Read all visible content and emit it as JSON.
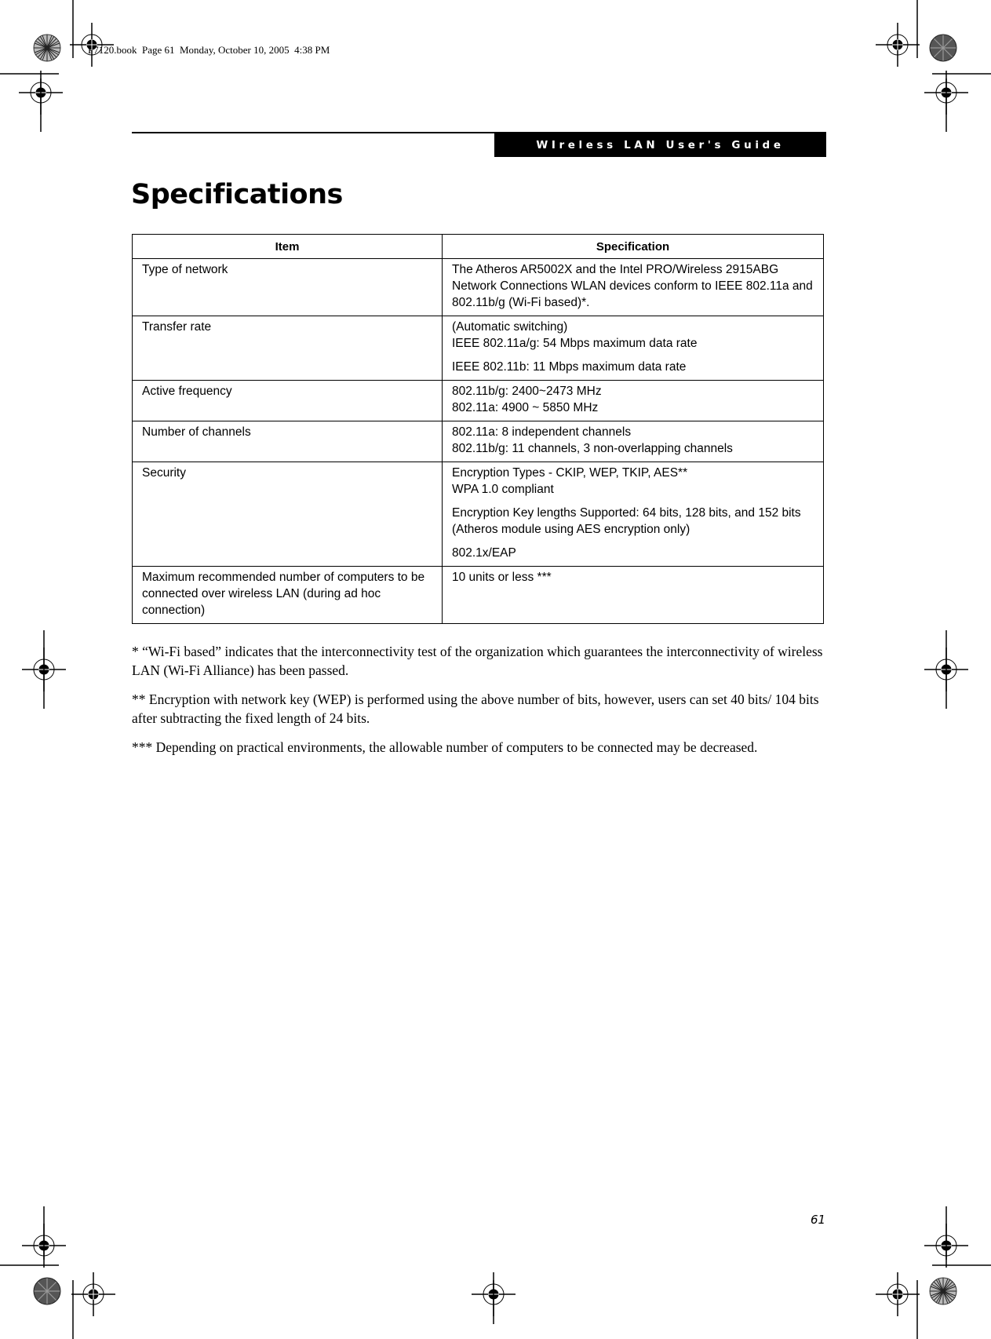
{
  "slug": "P7120.book  Page 61  Monday, October 10, 2005  4:38 PM",
  "header": {
    "running_title": "WIreless LAN User's Guide"
  },
  "page_title": "Specifications",
  "spec_table": {
    "headers": [
      "Item",
      "Specification"
    ],
    "rows": [
      {
        "item": "Type of network",
        "spec": [
          "The Atheros AR5002X and the Intel PRO/Wireless 2915ABG Network Connections WLAN devices conform to IEEE 802.11a and 802.11b/g (Wi-Fi based)*."
        ]
      },
      {
        "item": "Transfer rate",
        "spec": [
          "(Automatic switching)\nIEEE 802.11a/g: 54 Mbps maximum data rate",
          "IEEE 802.11b: 11 Mbps maximum data rate"
        ]
      },
      {
        "item": "Active frequency",
        "spec": [
          "802.11b/g: 2400~2473 MHz\n802.11a: 4900 ~ 5850 MHz"
        ]
      },
      {
        "item": "Number of channels",
        "spec": [
          "802.11a: 8 independent channels\n802.11b/g: 11 channels, 3 non-overlapping channels"
        ]
      },
      {
        "item": "Security",
        "spec": [
          "Encryption Types - CKIP, WEP, TKIP, AES**\nWPA 1.0 compliant",
          "Encryption Key lengths Supported: 64 bits, 128 bits, and 152 bits (Atheros module using AES encryption only)",
          "802.1x/EAP"
        ]
      },
      {
        "item": "Maximum recommended number of computers to be connected over wireless LAN (during ad hoc connection)",
        "spec": [
          "10 units or less ***"
        ]
      }
    ]
  },
  "footnotes": [
    "* “Wi-Fi based” indicates that the interconnectivity test of the organization which guarantees the interconnectivity of wireless LAN (Wi-Fi Alliance) has been passed.",
    "** Encryption with network key (WEP) is performed using the above number of bits, however, users can set 40 bits/ 104 bits after subtracting the fixed length of 24 bits.",
    "*** Depending on practical environments, the allowable number of computers to be connected may be decreased."
  ],
  "page_number": "61"
}
